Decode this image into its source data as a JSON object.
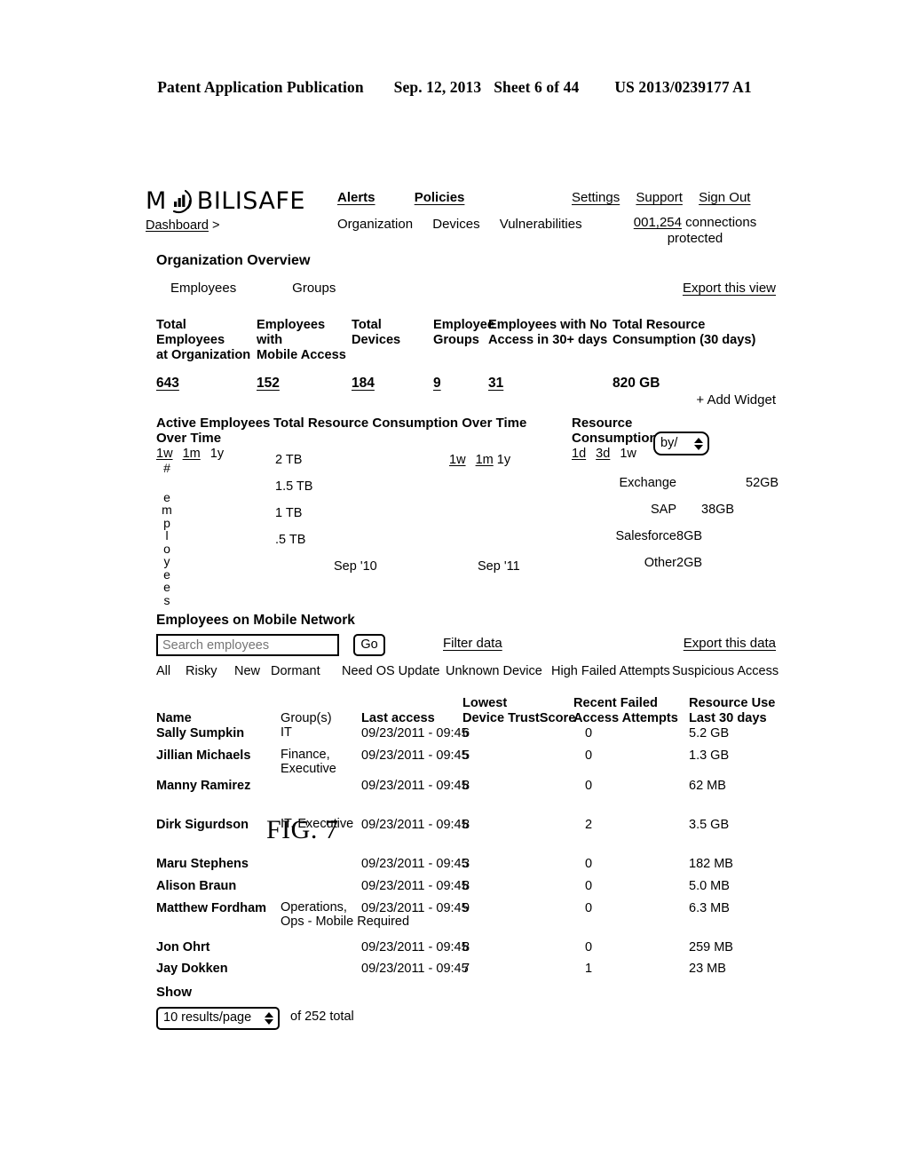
{
  "patent_header": {
    "publication": "Patent Application Publication",
    "date": "Sep. 12, 2013",
    "sheet": "Sheet 6 of 44",
    "number": "US 2013/0239177 A1"
  },
  "figure_label": "FIG. 7",
  "app": {
    "logo": {
      "text_before": "M",
      "text_after": "BILISAFE",
      "icon": "bar-chart-swoosh-icon"
    },
    "breadcrumb": {
      "crumb": "Dashboard",
      "separator": ">"
    },
    "nav_primary": [
      "Alerts",
      "Policies"
    ],
    "nav_secondary": [
      "Organization",
      "Devices",
      "Vulnerabilities"
    ],
    "nav_account": [
      "Settings",
      "Support",
      "Sign Out"
    ],
    "connections": {
      "count": "001,254",
      "label": "connections",
      "label2": "protected"
    },
    "section_title": "Organization Overview",
    "view_tabs": [
      "Employees",
      "Groups"
    ],
    "export_view": "Export this view",
    "add_widget": "+ Add Widget",
    "metrics": [
      {
        "label": "Total Employees at Organization",
        "label_line1": "Total Employees",
        "label_line2": "at Organization",
        "value": "643",
        "underlined": true
      },
      {
        "label": "Employees with Mobile Access",
        "label_line1": "Employees with",
        "label_line2": "Mobile Access",
        "value": "152",
        "underlined": true
      },
      {
        "label": "Total Devices",
        "label_line1": "Total Devices",
        "label_line2": "",
        "value": "184",
        "underlined": true
      },
      {
        "label": "Employee Groups",
        "label_line1": "Employee",
        "label_line2": "Groups",
        "value": "9",
        "underlined": true
      },
      {
        "label": "Employees with No Access in 30+ days",
        "label_line1": "Employees with No",
        "label_line2": "Access in 30+ days",
        "value": "31",
        "underlined": true
      },
      {
        "label": "Total Resource Consumption (30 days)",
        "label_line1": "Total Resource",
        "label_line2": "Consumption (30 days)",
        "value": "820 GB",
        "underlined": false
      }
    ],
    "widgets": {
      "active_employees": {
        "title_line1": "Active Employees",
        "title_line2": "Over Time",
        "ranges": [
          "1w",
          "1m",
          "1y"
        ],
        "axis_hash": "#",
        "axis_label": "employees"
      },
      "total_resource": {
        "title": "Total Resource Consumption Over Time",
        "ranges": [
          "1w",
          "1m",
          "1y"
        ],
        "y_ticks": [
          "2 TB",
          "1.5 TB",
          "1 TB",
          ".5 TB"
        ],
        "x_ticks": [
          "Sep '10",
          "Sep '11"
        ]
      },
      "resource_consumption": {
        "title_line1": "Resource",
        "title_line2": "Consumption",
        "ranges": [
          "1d",
          "3d",
          "1w"
        ],
        "by_select": "by/",
        "rows": [
          {
            "name": "Exchange",
            "value": "52GB"
          },
          {
            "name": "SAP",
            "value": "38GB"
          },
          {
            "name": "Salesforce",
            "value": "8GB"
          },
          {
            "name": "Other",
            "value": "2GB"
          }
        ]
      }
    },
    "employees_panel": {
      "title": "Employees on Mobile Network",
      "search_placeholder": "Search employees",
      "search_value": "",
      "go_label": "Go",
      "filter_data": "Filter data",
      "export_data": "Export this data",
      "filter_tabs": [
        "All",
        "Risky",
        "New",
        "Dormant",
        "Need OS Update",
        "Unknown Device",
        "High Failed Attempts",
        "Suspicious Access"
      ],
      "columns": [
        {
          "line1": "",
          "line2": "Name"
        },
        {
          "line1": "",
          "line2": "Group(s)"
        },
        {
          "line1": "",
          "line2": "Last access"
        },
        {
          "line1": "Lowest",
          "line2": "Device TrustScore"
        },
        {
          "line1": "Recent Failed",
          "line2": "Access Attempts"
        },
        {
          "line1": "Resource Use",
          "line2": "Last 30 days"
        }
      ],
      "rows": [
        {
          "name": "Sally Sumpkin",
          "groups": "IT",
          "groups2": "",
          "last_access": "09/23/2011 - 09:45",
          "trust_score": "6",
          "failed": "0",
          "resource": "5.2 GB"
        },
        {
          "name": "Jillian Michaels",
          "groups": "Finance,",
          "groups2": "Executive",
          "last_access": "09/23/2011 - 09:45",
          "trust_score": "5",
          "failed": "0",
          "resource": "1.3 GB"
        },
        {
          "name": "Manny Ramirez",
          "groups": "",
          "groups2": "",
          "last_access": "09/23/2011 - 09:45",
          "trust_score": "8",
          "failed": "0",
          "resource": "62 MB"
        },
        {
          "name": "Dirk Sigurdson",
          "groups": "IT, Executive",
          "groups2": "",
          "last_access": "09/23/2011 - 09:45",
          "trust_score": "8",
          "failed": "2",
          "resource": "3.5 GB"
        },
        {
          "name": "Maru Stephens",
          "groups": "",
          "groups2": "",
          "last_access": "09/23/2011 - 09:45",
          "trust_score": "3",
          "failed": "0",
          "resource": "182 MB"
        },
        {
          "name": "Alison Braun",
          "groups": "",
          "groups2": "",
          "last_access": "09/23/2011 - 09:45",
          "trust_score": "8",
          "failed": "0",
          "resource": "5.0 MB"
        },
        {
          "name": "Matthew Fordham",
          "groups": "Operations,",
          "groups2": "Ops - Mobile Required",
          "last_access": "09/23/2011 - 09:45",
          "trust_score": "9",
          "failed": "0",
          "resource": "6.3 MB"
        },
        {
          "name": "Jon Ohrt",
          "groups": "",
          "groups2": "",
          "last_access": "09/23/2011 - 09:45",
          "trust_score": "8",
          "failed": "0",
          "resource": "259 MB"
        },
        {
          "name": "Jay Dokken",
          "groups": "",
          "groups2": "",
          "last_access": "09/23/2011 - 09:45",
          "trust_score": "7",
          "failed": "1",
          "resource": "23 MB"
        }
      ],
      "show_label": "Show",
      "results_per_page": "10 results/page",
      "results_total": "of 252 total"
    }
  },
  "chart_data": [
    {
      "type": "line",
      "title": "Active Employees Over Time",
      "xlabel": "",
      "ylabel": "# employees",
      "ranges": [
        "1w",
        "1m",
        "1y"
      ],
      "selected_ranges": [
        "1w",
        "1m"
      ],
      "series": [],
      "grid": false
    },
    {
      "type": "line",
      "title": "Total Resource Consumption Over Time",
      "xlabel": "",
      "ylabel": "",
      "ranges": [
        "1w",
        "1m",
        "1y"
      ],
      "selected_ranges": [
        "1w",
        "1m"
      ],
      "y_ticks": [
        "2 TB",
        "1.5 TB",
        "1 TB",
        ".5 TB"
      ],
      "x_ticks": [
        "Sep '10",
        "Sep '11"
      ],
      "series": [],
      "grid": false
    },
    {
      "type": "bar",
      "title": "Resource Consumption",
      "categories": [
        "Exchange",
        "SAP",
        "Salesforce",
        "Other"
      ],
      "values": [
        52,
        38,
        8,
        2
      ],
      "value_labels": [
        "52GB",
        "38GB",
        "8GB",
        "2GB"
      ],
      "ylabel": "GB",
      "ranges": [
        "1d",
        "3d",
        "1w"
      ],
      "selected_ranges": [
        "1d",
        "3d"
      ]
    }
  ]
}
